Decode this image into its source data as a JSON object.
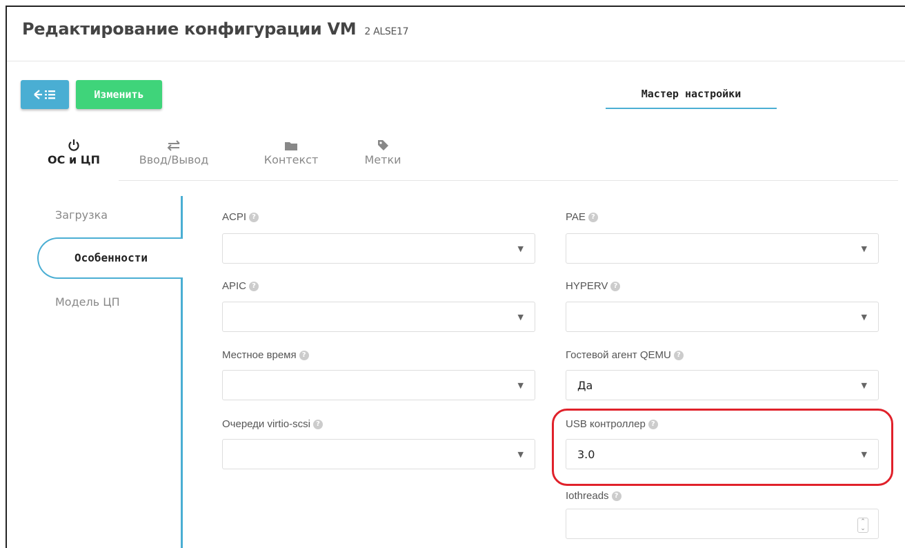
{
  "header": {
    "title": "Редактирование конфигурации VM",
    "subtitle": "2 ALSE17"
  },
  "toolbar": {
    "back_icon": "back-list-icon",
    "edit_label": "Изменить",
    "wizard_label": "Мастер настройки"
  },
  "tabs": [
    {
      "label": "ОС и ЦП",
      "icon": "power-icon",
      "active": true
    },
    {
      "label": "Ввод/Вывод",
      "icon": "arrows-exchange-icon",
      "active": false
    },
    {
      "label": "Контекст",
      "icon": "folder-icon",
      "active": false
    },
    {
      "label": "Метки",
      "icon": "tag-icon",
      "active": false
    }
  ],
  "sidebar": {
    "items": [
      {
        "label": "Загрузка",
        "active": false
      },
      {
        "label": "Особенности",
        "active": true
      },
      {
        "label": "Модель ЦП",
        "active": false
      }
    ]
  },
  "fields": {
    "acpi": {
      "label": "ACPI",
      "value": ""
    },
    "pae": {
      "label": "PAE",
      "value": ""
    },
    "apic": {
      "label": "APIC",
      "value": ""
    },
    "hyperv": {
      "label": "HYPERV",
      "value": ""
    },
    "localtime": {
      "label": "Местное время",
      "value": ""
    },
    "qemu_agent": {
      "label": "Гостевой агент QEMU",
      "value": "Да"
    },
    "virtio_scsi": {
      "label": "Очереди virtio-scsi",
      "value": ""
    },
    "usb": {
      "label": "USB контроллер",
      "value": "3.0"
    },
    "iothreads": {
      "label": "Iothreads",
      "value": ""
    }
  },
  "help_glyph": "?",
  "caret_glyph": "▼",
  "colors": {
    "accent": "#4aaed3",
    "edit_button": "#3fd47a",
    "highlight": "#e0212a"
  }
}
